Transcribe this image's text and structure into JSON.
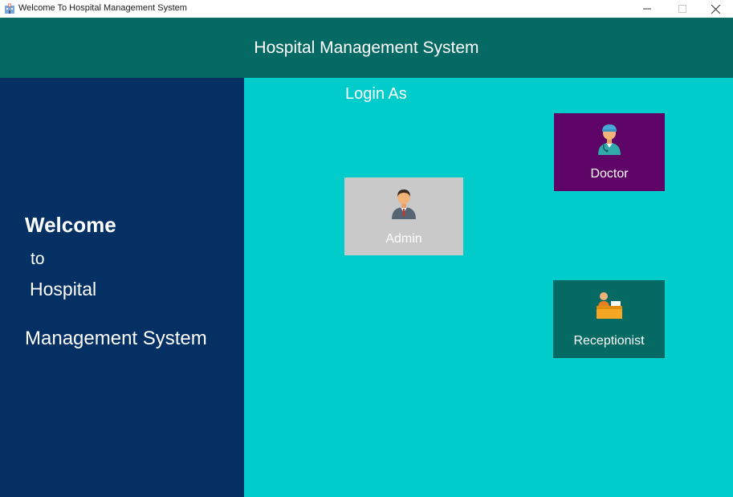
{
  "window": {
    "title": "Welcome To Hospital Management System",
    "app_icon": "hospital-building-icon",
    "controls": [
      "minimize-icon",
      "maximize-icon",
      "close-icon"
    ]
  },
  "header": {
    "title": "Hospital Management System"
  },
  "welcome_panel": {
    "line1": "Welcome",
    "line2": "to",
    "line3": "Hospital",
    "line4": "Management System"
  },
  "login": {
    "heading": "Login As",
    "roles": [
      {
        "label": "Admin",
        "icon": "admin-user-icon",
        "color": "#c9c9c9"
      },
      {
        "label": "Doctor",
        "icon": "doctor-icon",
        "color": "#5d0466"
      },
      {
        "label": "Receptionist",
        "icon": "receptionist-icon",
        "color": "#066a64"
      }
    ]
  },
  "colors": {
    "header_bg": "#066a64",
    "left_panel_bg": "#053064",
    "right_panel_bg": "#00cccc"
  }
}
